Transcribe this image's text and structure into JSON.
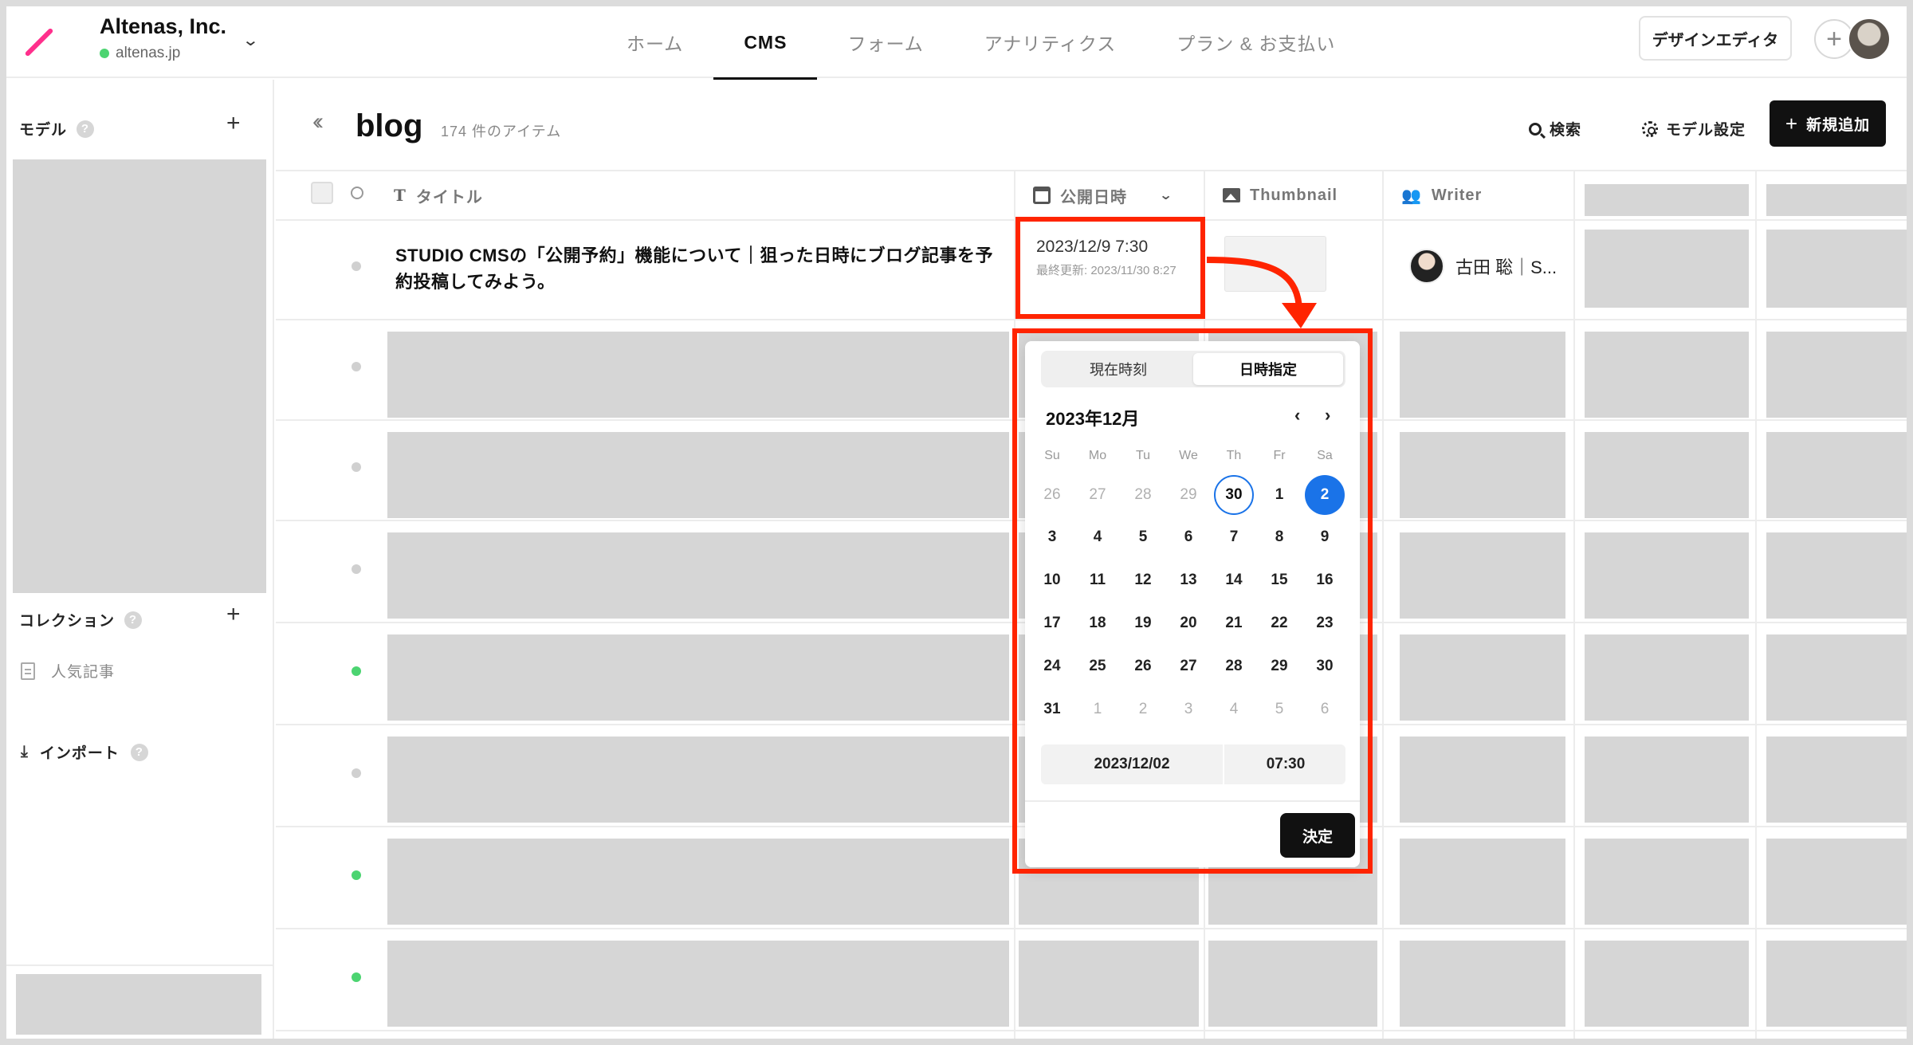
{
  "workspace": {
    "name": "Altenas, Inc.",
    "domain": "altenas.jp"
  },
  "nav": {
    "items": [
      "ホーム",
      "CMS",
      "フォーム",
      "アナリティクス",
      "プラン & お支払い"
    ],
    "active": "CMS"
  },
  "topbar": {
    "design_editor": "デザインエディタ"
  },
  "sidebar": {
    "models_heading": "モデル",
    "collections_heading": "コレクション",
    "collection_items": [
      "人気記事"
    ],
    "import_label": "インポート",
    "help": "?",
    "plus": "+"
  },
  "page": {
    "title": "blog",
    "count": "174 件のアイテム",
    "search_label": "検索",
    "model_settings_label": "モデル設定",
    "add_label": "新規追加"
  },
  "table": {
    "columns": {
      "title": "タイトル",
      "published": "公開日時",
      "thumbnail": "Thumbnail",
      "writer": "Writer"
    },
    "first_row": {
      "title": "STUDIO CMSの「公開予約」機能について｜狙った日時にブログ記事を予約投稿してみよう。",
      "date": "2023/12/9 7:30",
      "last_updated": "最終更新: 2023/11/30 8:27",
      "writer": "古田 聡｜S..."
    },
    "row_status": [
      "gray",
      "gray",
      "gray",
      "gray",
      "green",
      "gray",
      "green",
      "green"
    ]
  },
  "datepicker": {
    "tab_now": "現在時刻",
    "tab_specified": "日時指定",
    "month_label": "2023年12月",
    "prev": "‹",
    "next": "›",
    "weekdays": [
      "Su",
      "Mo",
      "Tu",
      "We",
      "Th",
      "Fr",
      "Sa"
    ],
    "weeks": [
      [
        "26",
        "27",
        "28",
        "29",
        "30",
        "1",
        "2"
      ],
      [
        "3",
        "4",
        "5",
        "6",
        "7",
        "8",
        "9"
      ],
      [
        "10",
        "11",
        "12",
        "13",
        "14",
        "15",
        "16"
      ],
      [
        "17",
        "18",
        "19",
        "20",
        "21",
        "22",
        "23"
      ],
      [
        "24",
        "25",
        "26",
        "27",
        "28",
        "29",
        "30"
      ],
      [
        "31",
        "1",
        "2",
        "3",
        "4",
        "5",
        "6"
      ]
    ],
    "outside_month": [
      [
        0,
        0
      ],
      [
        0,
        1
      ],
      [
        0,
        2
      ],
      [
        0,
        3
      ],
      [
        0,
        4
      ],
      [
        5,
        1
      ],
      [
        5,
        2
      ],
      [
        5,
        3
      ],
      [
        5,
        4
      ],
      [
        5,
        5
      ],
      [
        5,
        6
      ]
    ],
    "today": [
      0,
      4
    ],
    "selected": [
      0,
      6
    ],
    "date_value": "2023/12/02",
    "time_value": "07:30",
    "confirm": "決定"
  },
  "colors": {
    "accent_blue": "#1a73e8",
    "highlight_red": "#ff2400",
    "status_green": "#4cd471",
    "logo_pink": "#ff2f8c"
  }
}
